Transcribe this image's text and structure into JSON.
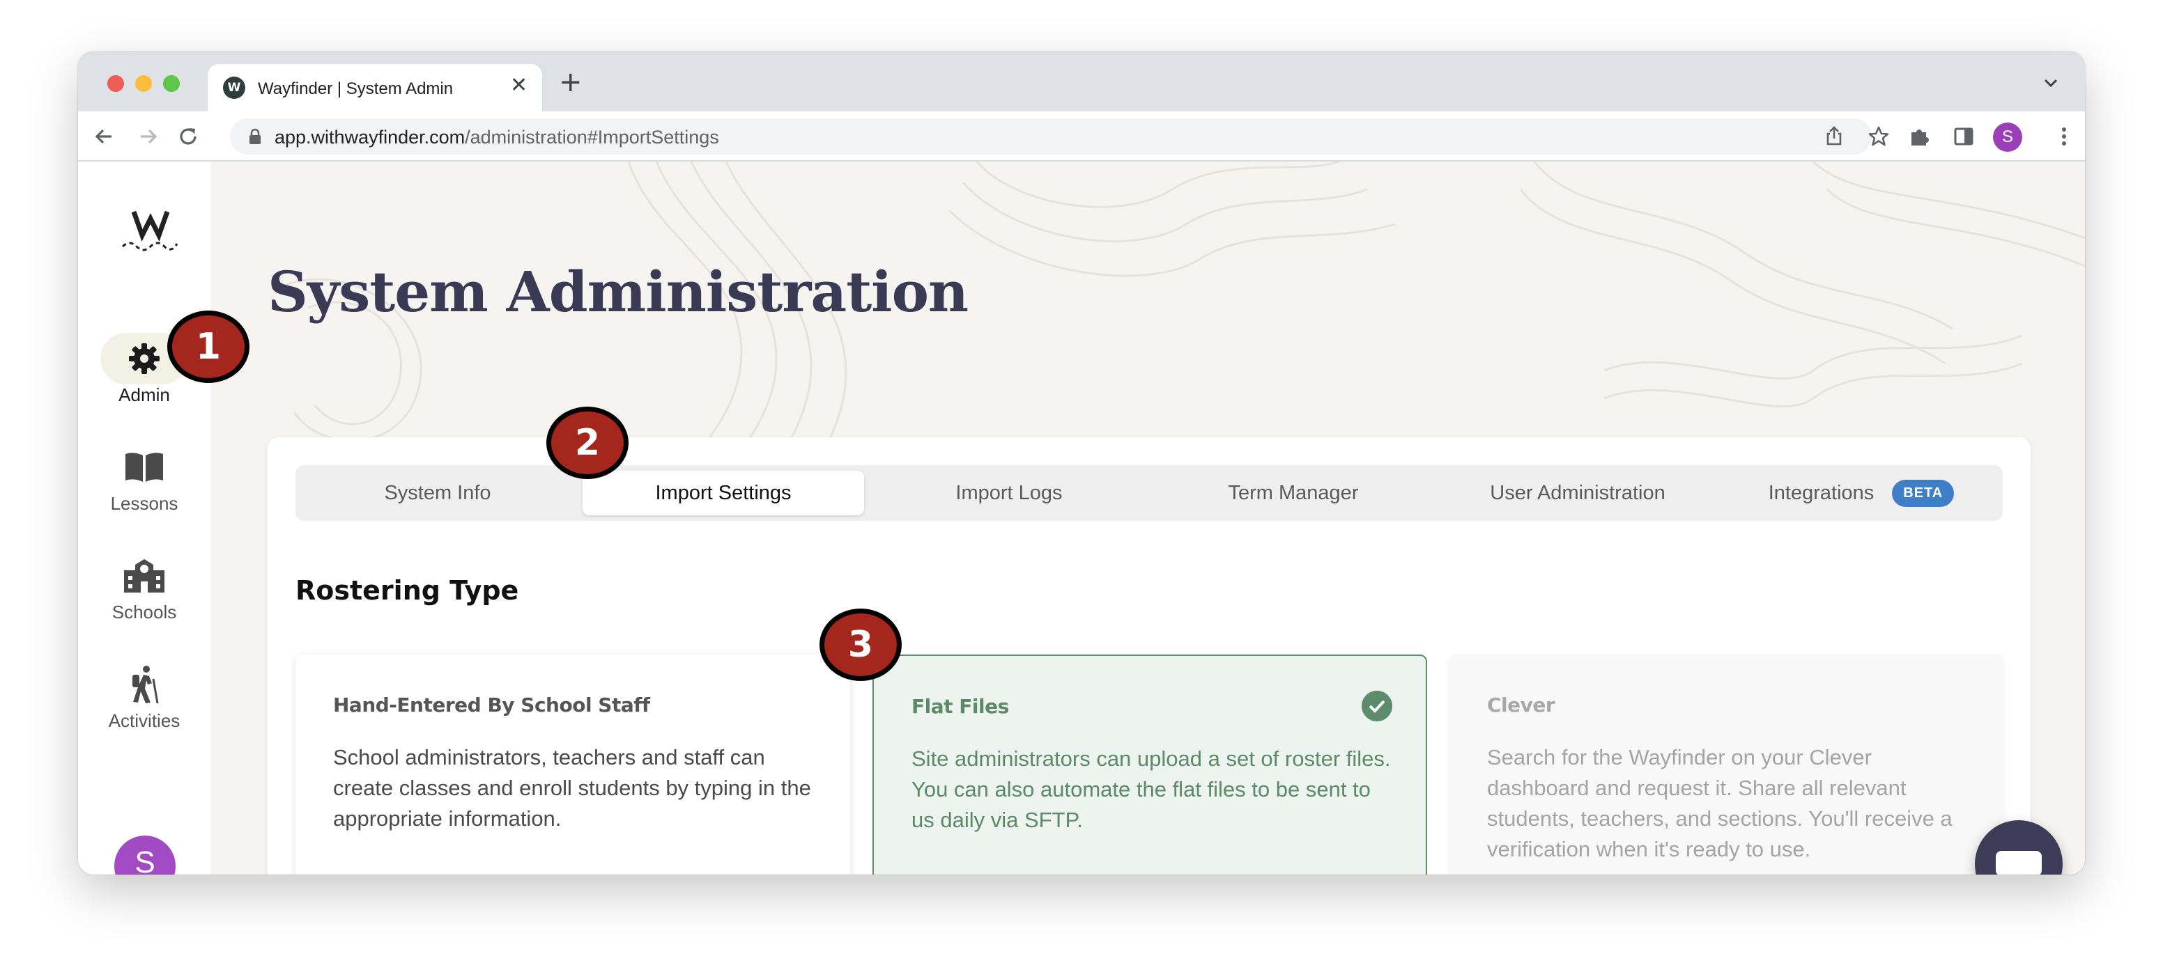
{
  "browser": {
    "tab_title": "Wayfinder | System Admin",
    "favicon_letter": "W",
    "close_symbol": "✕",
    "new_tab_symbol": "+",
    "url_host": "app.withwayfinder.com",
    "url_path": "/administration#ImportSettings",
    "profile_initial": "S"
  },
  "sidebar": {
    "items": [
      {
        "label": "Admin",
        "icon": "gear-icon",
        "active": true
      },
      {
        "label": "Lessons",
        "icon": "book-icon",
        "active": false
      },
      {
        "label": "Schools",
        "icon": "school-icon",
        "active": false
      },
      {
        "label": "Activities",
        "icon": "hiker-icon",
        "active": false
      }
    ],
    "avatar_initial": "S"
  },
  "page": {
    "title": "System Administration"
  },
  "tabs": [
    {
      "label": "System Info",
      "active": false
    },
    {
      "label": "Import Settings",
      "active": true
    },
    {
      "label": "Import Logs",
      "active": false
    },
    {
      "label": "Term Manager",
      "active": false
    },
    {
      "label": "User Administration",
      "active": false
    },
    {
      "label": "Integrations",
      "active": false,
      "badge": "BETA"
    }
  ],
  "rostering": {
    "title": "Rostering Type",
    "options": [
      {
        "title": "Hand-Entered By School Staff",
        "description": "School administrators, teachers and staff can create classes and enroll students by typing in the appropriate information.",
        "selected": false
      },
      {
        "title": "Flat Files",
        "description": "Site administrators can upload a set of roster files. You can also automate the flat files to be sent to us daily via SFTP.",
        "selected": true
      },
      {
        "title": "Clever",
        "description": "Search for the Wayfinder on your Clever dashboard and request it. Share all relevant students, teachers, and sections. You'll receive a verification when it's ready to use.",
        "selected": false
      }
    ]
  },
  "markers": [
    "1",
    "2",
    "3"
  ],
  "colors": {
    "accent_green": "#5d8c6c",
    "beta_blue": "#3f7fc8",
    "title_navy": "#3a3a55",
    "marker_red": "#a5261c",
    "chat_button": "#3e3b58"
  }
}
